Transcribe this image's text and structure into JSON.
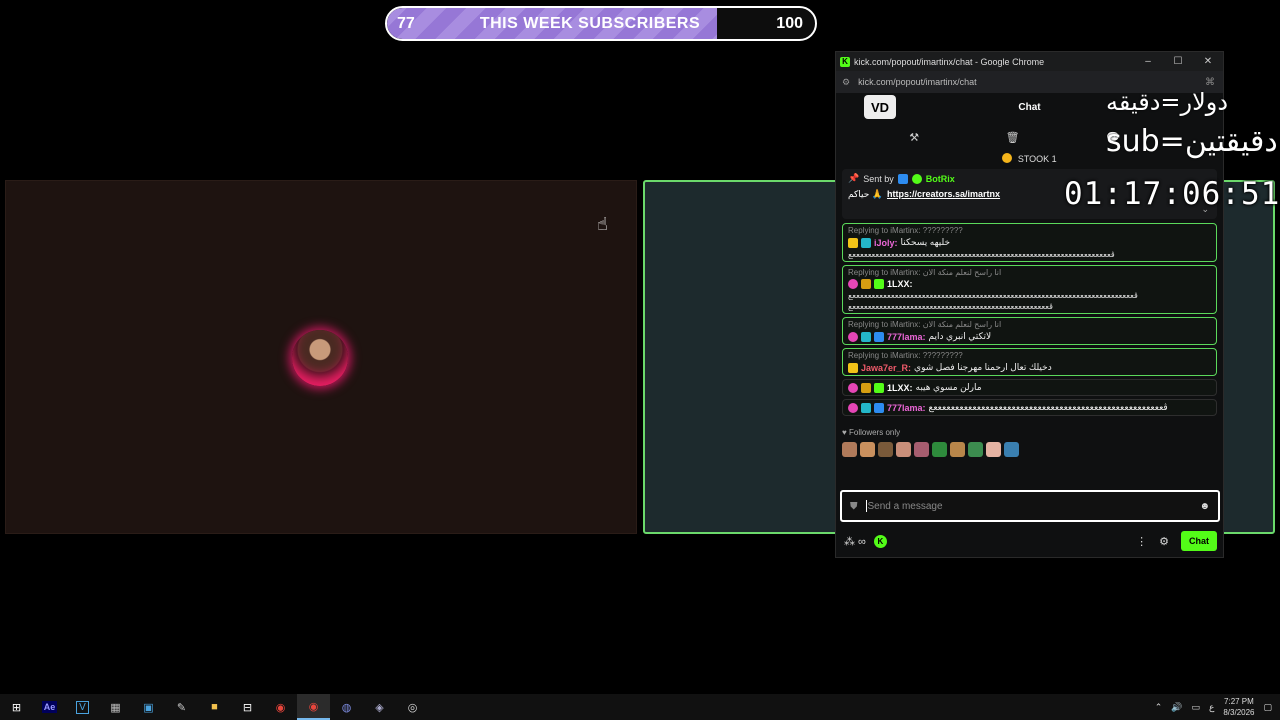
{
  "goal": {
    "current": "77",
    "target": "100",
    "title": "THIS WEEK SUBSCRIBERS",
    "progress": 0.77
  },
  "overlay": {
    "line1": "دولار=دقيقه",
    "line2": "sub=دقيقتين",
    "timer": "01:17:06:51"
  },
  "window": {
    "title": "kick.com/popout/imartinx/chat - Google Chrome",
    "url": "kick.com/popout/imartinx/chat",
    "controls": {
      "minimize": "–",
      "maximize": "☐",
      "close": "✕"
    }
  },
  "chat": {
    "header": "Chat",
    "logo": "VD",
    "tools": [
      "⚒",
      "🗑",
      "💬"
    ],
    "pinned_strip": {
      "label": "STOOK",
      "count": "1"
    },
    "pinned": {
      "sent_by": "Sent by",
      "bot": "BotRix",
      "greeting": "حياكم 🙏",
      "link": "https://creators.sa/imartnx"
    },
    "messages": [
      {
        "reply": "Replying to iMartinx: ?????????",
        "user": "iJoly:",
        "text": "خليهه يسحكنا",
        "spam": "ڨعععععععععععععععععععععععععععععععععععععععععععععععععععععععععععععععععععع",
        "user_color": "pink",
        "badges": [
          "yellow",
          "cyan"
        ]
      },
      {
        "reply": "Replying to iMartinx: انا راسح لنعلم منكة الان",
        "user": "1LXX:",
        "text": "",
        "spam": "ڨعععععععععععععععععععععععععععععععععععععععععععععععععععععععععععععععععععععععععع",
        "spam2": "ڨعععععععععععععععععععععععععععععععععععععععععععععععععععع",
        "user_color": "white",
        "badges": [
          "pink",
          "gold",
          "green"
        ]
      },
      {
        "reply": "Replying to iMartinx: انا راسح لنعلم منكة الان",
        "user": "777lama:",
        "text": "لاتكتي انبري دايم",
        "user_color": "pink",
        "badges": [
          "pink",
          "cyan",
          "blue"
        ]
      },
      {
        "reply": "Replying to iMartinx: ?????????",
        "user": "Jawa7er_R:",
        "text": "دخيلك تعال ارحمنا مهرجنا فصل شوي",
        "user_color": "red",
        "badges": [
          "yellow"
        ]
      },
      {
        "reply": "",
        "user": "1LXX:",
        "text": "مارلن مسوي هيبه",
        "user_color": "white",
        "badges": [
          "pink",
          "gold",
          "green"
        ],
        "plain": true
      },
      {
        "reply": "",
        "user": "777lama:",
        "text": "ڨعععععععععععععععععععععععععععععععععععععععععععععععععععععع",
        "user_color": "pink",
        "badges": [
          "pink",
          "cyan",
          "blue"
        ],
        "plain": true
      }
    ],
    "followers_only": "Followers only",
    "input_placeholder": "Send a message",
    "send_label": "Chat"
  },
  "taskbar": {
    "apps": [
      "start",
      "after-effects",
      "visual-studio",
      "calculator",
      "store",
      "pen",
      "explorer",
      "store-bag",
      "chrome",
      "chrome-active",
      "discord",
      "steam",
      "obs"
    ],
    "time": "7:27 PM",
    "date": "8/3/2026",
    "lang": "ع"
  },
  "colors": {
    "kick_green": "#53fc18",
    "goal_purple": "#9677d6",
    "highlight_border": "#5bd95b"
  }
}
